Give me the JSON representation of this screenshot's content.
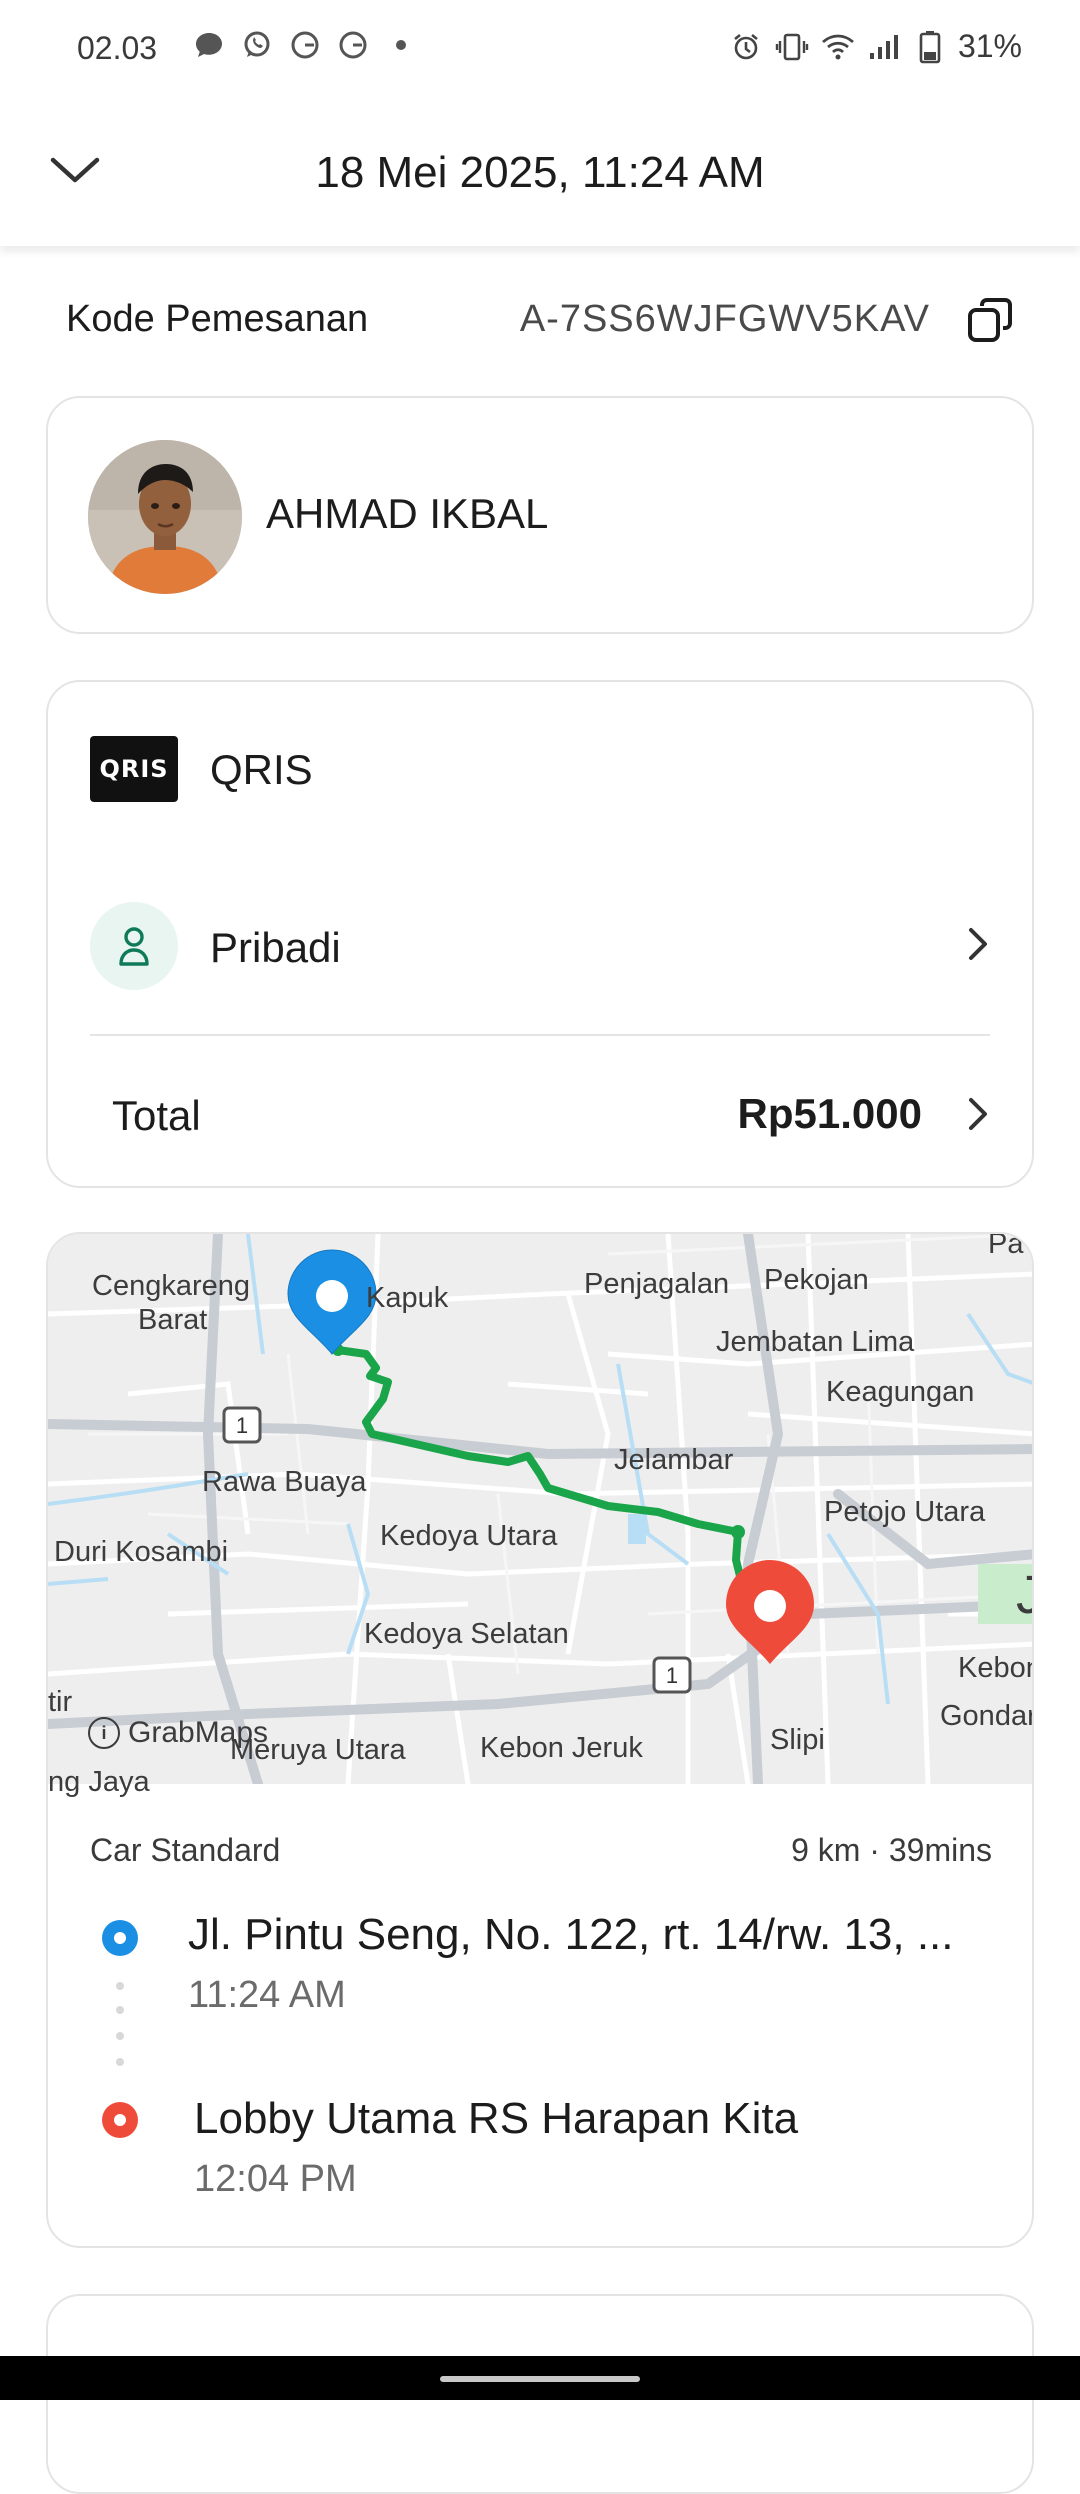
{
  "status_bar": {
    "time": "02.03",
    "battery": "31%",
    "notification_icons": [
      "message-icon",
      "whatsapp-icon",
      "google-icon",
      "google-icon",
      "dot-icon"
    ],
    "system_icons": [
      "alarm-icon",
      "vibrate-icon",
      "wifi-icon",
      "signal-icon",
      "battery-icon"
    ]
  },
  "header": {
    "title": "18 Mei 2025, 11:24 AM"
  },
  "order": {
    "code_label": "Kode Pemesanan",
    "code_value": "A-7SS6WJFGWV5KAV"
  },
  "driver": {
    "name": "AHMAD IKBAL"
  },
  "payment": {
    "logo_text": "QRIS",
    "method": "QRIS",
    "profile": "Pribadi",
    "total_label": "Total",
    "total_value": "Rp51.000"
  },
  "map": {
    "labels": {
      "cengkareng_1": "Cengkareng",
      "cengkareng_2": "Barat",
      "kapuk": "Kapuk",
      "penjagalan": "Penjagalan",
      "pekojan": "Pekojan",
      "jembatan_lima": "Jembatan Lima",
      "keagungan": "Keagungan",
      "rawa_buaya": "Rawa Buaya",
      "jelambar": "Jelambar",
      "petojo_utara": "Petojo Utara",
      "duri_kosambi": "Duri Kosambi",
      "kedoya_utara": "Kedoya Utara",
      "kedoya_selatan": "Kedoya Selatan",
      "meruya_utara": "Meruya Utara",
      "kebon_jeruk": "Kebon Jeruk",
      "slipi": "Slipi",
      "kebon": "Kebon",
      "gondar": "Gondar",
      "tir": "tir",
      "pa": "Pa",
      "j": "J",
      "ng_jaya": "ng Jaya"
    },
    "road_badges": [
      "1",
      "1"
    ],
    "attribution": "GrabMaps",
    "route_color": "#1aa54a",
    "pickup_color": "#1a8fe3",
    "dropoff_color": "#ef4b3a"
  },
  "trip": {
    "service": "Car Standard",
    "distance_duration": "9 km · 39mins",
    "pickup_address": "Jl. Pintu Seng, No. 122, rt. 14/rw. 13, ...",
    "pickup_time": "11:24 AM",
    "dropoff_address": "Lobby Utama RS Harapan Kita",
    "dropoff_time": "12:04 PM"
  }
}
